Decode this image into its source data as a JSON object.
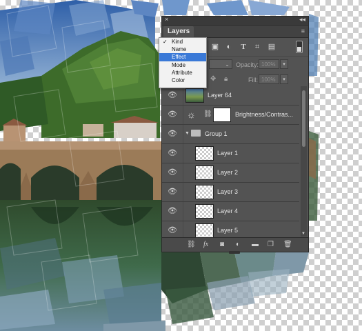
{
  "panel": {
    "tab_label": "Layers",
    "close_glyph": "×",
    "collapse_glyph": "◂◂",
    "menu_glyph": "≡",
    "opacity_label": "Opacity:",
    "opacity_value": "100%",
    "fill_label": "Fill:",
    "fill_value": "100%"
  },
  "kind_menu": {
    "items": [
      {
        "label": "Kind",
        "checked": true
      },
      {
        "label": "Name"
      },
      {
        "label": "Effect",
        "selected": true
      },
      {
        "label": "Mode"
      },
      {
        "label": "Attribute"
      },
      {
        "label": "Color"
      }
    ],
    "check_glyph": "✓"
  },
  "layers": [
    {
      "name": "Layer 64",
      "type": "image"
    },
    {
      "name": "Brightness/Contras...",
      "type": "adjustment"
    },
    {
      "name": "Group 1",
      "type": "group"
    },
    {
      "name": "Layer 1",
      "type": "layer"
    },
    {
      "name": "Layer 2",
      "type": "layer"
    },
    {
      "name": "Layer 3",
      "type": "layer"
    },
    {
      "name": "Layer 4",
      "type": "layer"
    },
    {
      "name": "Layer 5",
      "type": "layer"
    }
  ],
  "colors": {
    "panel_bg": "#535353",
    "selected_menu": "#3a79d7"
  }
}
